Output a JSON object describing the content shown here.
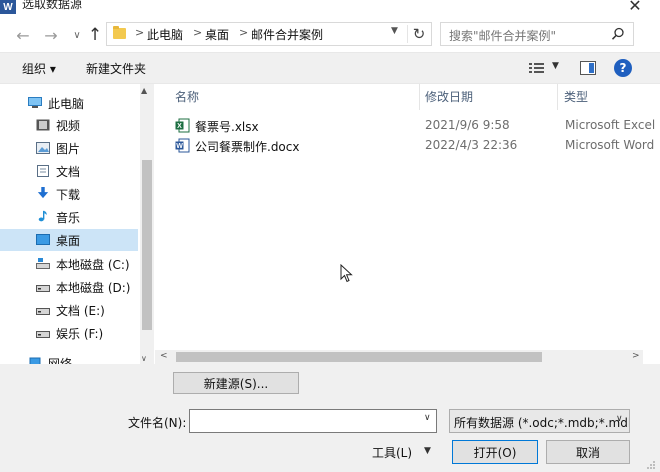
{
  "window": {
    "title": "选取数据源",
    "app_icon_letter": "W",
    "close_glyph": "✕"
  },
  "nav": {
    "back_glyph": "←",
    "forward_glyph": "→",
    "recent_glyph": "∨",
    "up_glyph": "↑",
    "refresh_glyph": "↻"
  },
  "address": {
    "crumbs": [
      "此电脑",
      "桌面",
      "邮件合并案例"
    ],
    "separator": ">"
  },
  "search": {
    "placeholder": "搜索\"邮件合并案例\""
  },
  "toolbar": {
    "organize_label": "组织 ▾",
    "new_folder_label": "新建文件夹",
    "help_glyph": "?"
  },
  "sidebar": {
    "items": [
      {
        "label": "此电脑",
        "icon": "computer-icon"
      },
      {
        "label": "视频",
        "icon": "video-icon"
      },
      {
        "label": "图片",
        "icon": "pictures-icon"
      },
      {
        "label": "文档",
        "icon": "documents-icon"
      },
      {
        "label": "下载",
        "icon": "download-icon"
      },
      {
        "label": "音乐",
        "icon": "music-icon"
      },
      {
        "label": "桌面",
        "icon": "desktop-icon",
        "selected": true
      },
      {
        "label": "本地磁盘 (C:)",
        "icon": "drive-c-icon"
      },
      {
        "label": "本地磁盘 (D:)",
        "icon": "drive-icon"
      },
      {
        "label": "文档 (E:)",
        "icon": "drive-icon"
      },
      {
        "label": "娱乐 (F:)",
        "icon": "drive-icon"
      },
      {
        "label": "网络",
        "icon": "network-icon"
      }
    ]
  },
  "filelist": {
    "columns": [
      "名称",
      "修改日期",
      "类型"
    ],
    "files": [
      {
        "name": "餐票号.xlsx",
        "date": "2021/9/6 9:58",
        "type": "Microsoft Excel",
        "icon": "excel-file-icon"
      },
      {
        "name": "公司餐票制作.docx",
        "date": "2022/4/3 22:36",
        "type": "Microsoft Word",
        "icon": "word-file-icon"
      }
    ]
  },
  "bottom": {
    "new_source_label": "新建源(S)...",
    "filename_label": "文件名(N):",
    "filename_value": "",
    "filter_label": "所有数据源 (*.odc;*.mdb;*.mdb",
    "tools_label": "工具(L)",
    "open_label": "打开(O)",
    "cancel_label": "取消"
  },
  "colors": {
    "selection": "#cce4f7",
    "accent": "#0078d7",
    "excel_green": "#1d6f42",
    "word_blue": "#2b579a"
  }
}
